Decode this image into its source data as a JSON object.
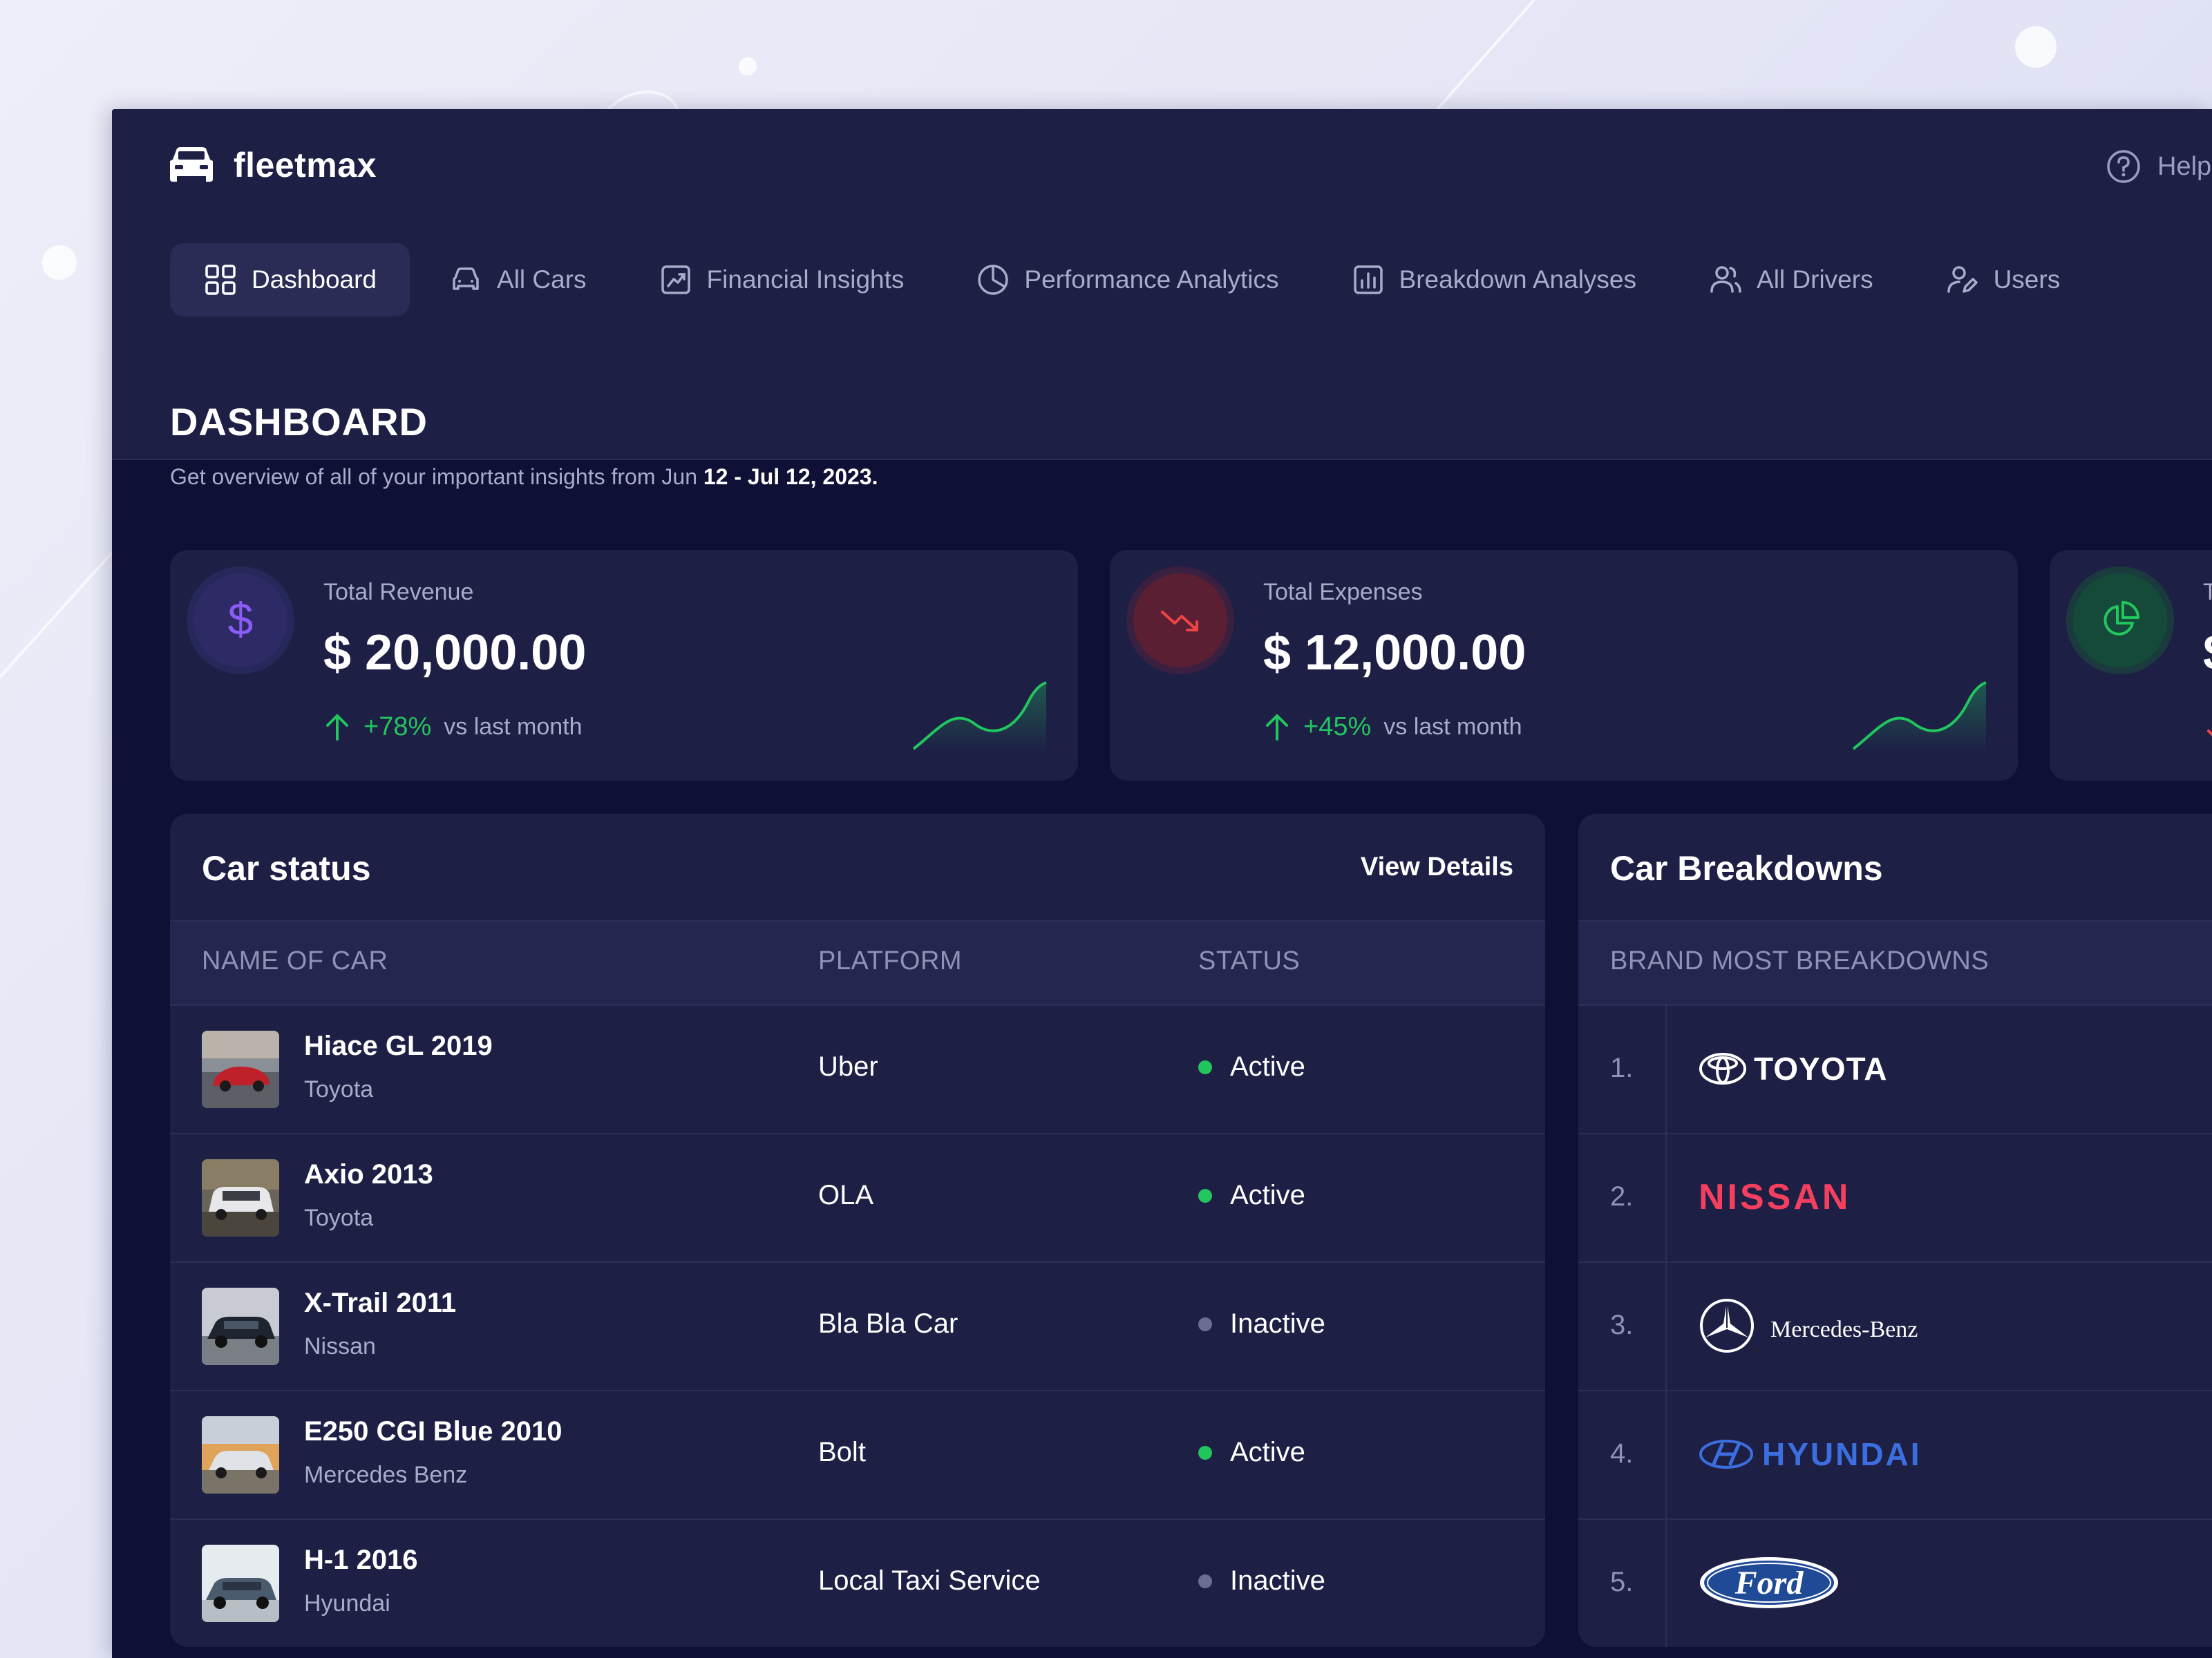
{
  "app": {
    "name": "fleetmax",
    "help_label": "Help"
  },
  "nav": [
    {
      "label": "Dashboard",
      "icon": "grid-icon",
      "active": true
    },
    {
      "label": "All Cars",
      "icon": "car-icon"
    },
    {
      "label": "Financial Insights",
      "icon": "chart-line-icon"
    },
    {
      "label": "Performance Analytics",
      "icon": "pie-chart-icon"
    },
    {
      "label": "Breakdown Analyses",
      "icon": "bar-chart-icon"
    },
    {
      "label": "All Drivers",
      "icon": "users-icon"
    },
    {
      "label": "Users",
      "icon": "user-edit-icon"
    }
  ],
  "page": {
    "title": "DASHBOARD",
    "subtitle_prefix": "Get overview of all of your important insights from Jun",
    "subtitle_range": "12 - Jul 12, 2023."
  },
  "kpis": [
    {
      "label": "Total Revenue",
      "value": "$ 20,000.00",
      "change": "+78%",
      "vs": "vs last month",
      "icon": "dollar-icon",
      "accent": "#8b5cf6"
    },
    {
      "label": "Total Expenses",
      "value": "$ 12,000.00",
      "change": "+45%",
      "vs": "vs last month",
      "icon": "trend-down-icon",
      "accent": "#ef4444"
    },
    {
      "label": "T",
      "value": "$",
      "icon": "pie-chart-icon",
      "accent": "#22c55e"
    }
  ],
  "car_status": {
    "title": "Car status",
    "link": "View Details",
    "columns": [
      "NAME OF CAR",
      "PLATFORM",
      "STATUS"
    ],
    "rows": [
      {
        "name": "Hiace GL 2019",
        "brand": "Toyota",
        "platform": "Uber",
        "status": "Active"
      },
      {
        "name": "Axio 2013",
        "brand": "Toyota",
        "platform": "OLA",
        "status": "Active"
      },
      {
        "name": "X-Trail 2011",
        "brand": "Nissan",
        "platform": "Bla Bla Car",
        "status": "Inactive"
      },
      {
        "name": "E250 CGI Blue 2010",
        "brand": "Mercedes Benz",
        "platform": "Bolt",
        "status": "Active"
      },
      {
        "name": "H-1 2016",
        "brand": "Hyundai",
        "platform": "Local Taxi Service",
        "status": "Inactive"
      }
    ],
    "status_colors": {
      "Active": "#22c55e",
      "Inactive": "#6b6e93"
    }
  },
  "breakdowns": {
    "title": "Car Breakdowns",
    "column": "BRAND MOST BREAKDOWNS",
    "items": [
      {
        "rank": "1.",
        "brand": "TOYOTA",
        "color": "#ffffff"
      },
      {
        "rank": "2.",
        "brand": "NISSAN",
        "color": "#f43f5e"
      },
      {
        "rank": "3.",
        "brand": "Mercedes-Benz",
        "color": "#ffffff"
      },
      {
        "rank": "4.",
        "brand": "HYUNDAI",
        "color": "#3b6fe0"
      },
      {
        "rank": "5.",
        "brand": "Ford",
        "color": "#ffffff"
      }
    ]
  }
}
